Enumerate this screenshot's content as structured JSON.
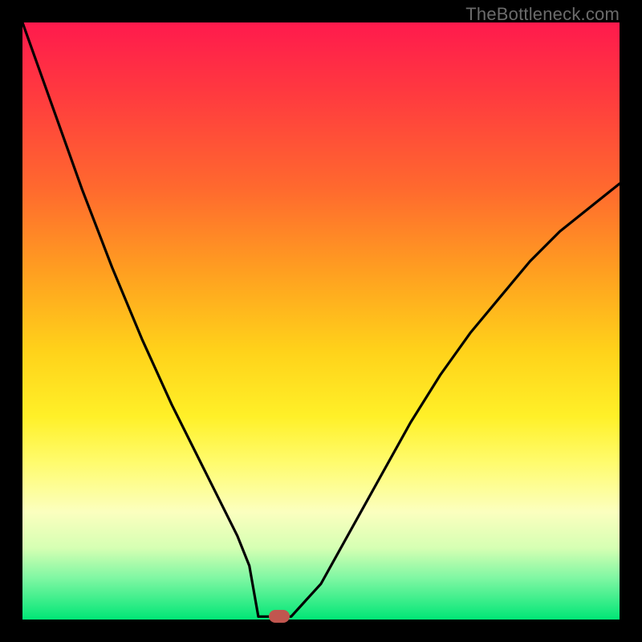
{
  "watermark": "TheBottleneck.com",
  "chart_data": {
    "type": "line",
    "title": "",
    "xlabel": "",
    "ylabel": "",
    "xlim": [
      0,
      100
    ],
    "ylim": [
      0,
      100
    ],
    "grid": false,
    "series": [
      {
        "name": "curve",
        "color": "#000000",
        "x": [
          0,
          5,
          10,
          15,
          20,
          25,
          30,
          33,
          36,
          38,
          39.5,
          41,
          42.5,
          45,
          50,
          55,
          60,
          65,
          70,
          75,
          80,
          85,
          90,
          95,
          100
        ],
        "y": [
          100,
          86,
          72,
          59,
          47,
          36,
          26,
          20,
          14,
          9,
          5,
          2,
          0.5,
          0.5,
          6,
          15,
          24,
          33,
          41,
          48,
          54,
          60,
          65,
          69,
          73
        ]
      }
    ],
    "flat_segment": {
      "x_start": 39.5,
      "x_end": 45,
      "y": 0.5
    },
    "marker": {
      "x": 43,
      "y": 0.5,
      "color": "#c1564f"
    },
    "gradient_stops": [
      {
        "pos": 0,
        "color": "#ff1a4d"
      },
      {
        "pos": 12,
        "color": "#ff3a3f"
      },
      {
        "pos": 28,
        "color": "#ff6a2e"
      },
      {
        "pos": 42,
        "color": "#ffa020"
      },
      {
        "pos": 55,
        "color": "#ffd21a"
      },
      {
        "pos": 66,
        "color": "#fff028"
      },
      {
        "pos": 74,
        "color": "#fffc70"
      },
      {
        "pos": 82,
        "color": "#fbffbf"
      },
      {
        "pos": 88,
        "color": "#d6ffb3"
      },
      {
        "pos": 93,
        "color": "#80f7a3"
      },
      {
        "pos": 100,
        "color": "#00e676"
      }
    ]
  }
}
